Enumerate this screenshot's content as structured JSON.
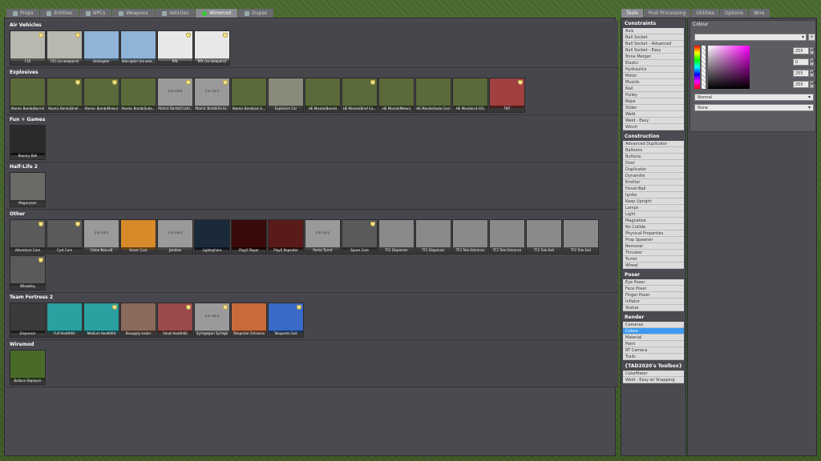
{
  "spawn_tabs": [
    {
      "label": "Props",
      "icon": "props-icon"
    },
    {
      "label": "Entities",
      "icon": "entities-icon"
    },
    {
      "label": "NPCs",
      "icon": "npcs-icon"
    },
    {
      "label": "Weapons",
      "icon": "weapons-icon"
    },
    {
      "label": "Vehicles",
      "icon": "vehicles-icon"
    },
    {
      "label": "Wiremod",
      "icon": "wiremod-icon",
      "active": true
    },
    {
      "label": "Dupes",
      "icon": "dupes-icon"
    }
  ],
  "categories": [
    {
      "title": "Air Vehicles",
      "items": [
        {
          "label": "F35",
          "color": "#b8b8b0",
          "badge": true
        },
        {
          "label": "F35 (no weapons)",
          "color": "#b8b8b0",
          "badge": true
        },
        {
          "label": "Helicopter",
          "color": "#8fb4d8",
          "badge": false
        },
        {
          "label": "Helicopter (no wea...",
          "color": "#8fb4d8",
          "badge": false
        },
        {
          "label": "RPL",
          "color": "#e8e8e8",
          "badge": true
        },
        {
          "label": "RPL (no weapons)",
          "color": "#e8e8e8",
          "badge": true
        }
      ]
    },
    {
      "title": "Explosives",
      "items": [
        {
          "label": "Atomic Bomb(Barrel)",
          "color": "#5a6a3a",
          "badge": false
        },
        {
          "label": "Atomic Bomb(Brief...",
          "color": "#5a6a3a",
          "badge": true
        },
        {
          "label": "Atomic Bomb(Melon)",
          "color": "#5a6a3a",
          "badge": true
        },
        {
          "label": "Atomic Bomb(Soda...",
          "color": "#5a6a3a",
          "badge": false
        },
        {
          "label": "Atomic Bomb(Custo...",
          "color": "#9a9a9a",
          "badge": true,
          "noicon": true
        },
        {
          "label": "Atomic Bomb(Invisi...",
          "color": "#9a9a9a",
          "badge": true,
          "noicon": true
        },
        {
          "label": "Atomic Bomb(s4-G...",
          "color": "#5a6a3a",
          "badge": false
        },
        {
          "label": "Explosive Car",
          "color": "#8a8a7a",
          "badge": false
        },
        {
          "label": "HE Missile(Barrel)",
          "color": "#5a6a3a",
          "badge": false
        },
        {
          "label": "HE Missile(Brief Ca...",
          "color": "#5a6a3a",
          "badge": true
        },
        {
          "label": "HE Missile(Melon)",
          "color": "#5a6a3a",
          "badge": false
        },
        {
          "label": "HE Missile(Soda Can)",
          "color": "#5a6a3a",
          "badge": false
        },
        {
          "label": "HE Missile(s4-G5)",
          "color": "#5a6a3a",
          "badge": false
        },
        {
          "label": "TNT",
          "color": "#a04040",
          "badge": true
        }
      ]
    },
    {
      "title": "Fun + Games",
      "items": [
        {
          "label": "Bouncy Ball",
          "color": "#2a2a2a",
          "badge": false
        }
      ]
    },
    {
      "title": "Half-Life 2",
      "items": [
        {
          "label": "Magnusson",
          "color": "#6a6a66",
          "badge": false
        }
      ]
    },
    {
      "title": "Other",
      "items": [
        {
          "label": "Adventure Core",
          "color": "#5a5a5a",
          "badge": true
        },
        {
          "label": "Cyst Core",
          "color": "#5a5a5a",
          "badge": true
        },
        {
          "label": "Globe Nexus8",
          "color": "#9a9a9a",
          "badge": false,
          "noicon": true
        },
        {
          "label": "Hover Core",
          "color": "#d88a2a",
          "badge": false
        },
        {
          "label": "Jukebox",
          "color": "#9a9a9a",
          "badge": false,
          "noicon": true
        },
        {
          "label": "Lightsphere",
          "color": "#1a2a3a",
          "badge": false
        },
        {
          "label": "PlayX Player",
          "color": "#3a0a0a",
          "badge": false
        },
        {
          "label": "PlayX Repeater",
          "color": "#5a1a1a",
          "badge": false
        },
        {
          "label": "Portal Turret",
          "color": "#9a9a9a",
          "badge": false,
          "noicon": true
        },
        {
          "label": "Space Core",
          "color": "#5a5a5a",
          "badge": true
        },
        {
          "label": "TF2 Dispenser",
          "color": "#8a8a8a",
          "badge": false
        },
        {
          "label": "TF2 Dispenser",
          "color": "#8a8a8a",
          "badge": false
        },
        {
          "label": "TF2 Tele Entrance",
          "color": "#8a8a8a",
          "badge": false
        },
        {
          "label": "TF2 Tele Entrance",
          "color": "#8a8a8a",
          "badge": false
        },
        {
          "label": "TF2 Tele Exit",
          "color": "#8a8a8a",
          "badge": false
        },
        {
          "label": "TF2 Tele Exit",
          "color": "#8a8a8a",
          "badge": false
        },
        {
          "label": "Wheatley",
          "color": "#5a5a5a",
          "badge": true
        }
      ]
    },
    {
      "title": "Team Fortress 2",
      "items": [
        {
          "label": "Dispenser",
          "color": "#3a3a3a",
          "badge": false
        },
        {
          "label": "Full HealthKit",
          "color": "#2aa0a0",
          "badge": false
        },
        {
          "label": "Medium HealthKit",
          "color": "#2aa0a0",
          "badge": true
        },
        {
          "label": "Resupply locker",
          "color": "#8a6a5a",
          "badge": false
        },
        {
          "label": "Small HealthKit",
          "color": "#9a4a4a",
          "badge": true
        },
        {
          "label": "Syringegun Syringe",
          "color": "#9a9a9a",
          "badge": true,
          "noicon": true
        },
        {
          "label": "Teleporter Entrance",
          "color": "#c86a3a",
          "badge": false
        },
        {
          "label": "Teleporter Exit",
          "color": "#3a6ac8",
          "badge": true
        }
      ]
    },
    {
      "title": "Wiremod",
      "items": [
        {
          "label": "Balloon Deployer",
          "color": "#4a6a2a",
          "badge": false
        }
      ]
    }
  ],
  "noicon_text": "(no icon)",
  "tool_tabs": [
    {
      "label": "Tools",
      "active": true
    },
    {
      "label": "Post Processing"
    },
    {
      "label": "Utilities"
    },
    {
      "label": "Options"
    },
    {
      "label": "Wire"
    }
  ],
  "tool_groups": [
    {
      "title": "Constraints",
      "items": [
        "Axis",
        "Ball Socket",
        "Ball Socket - Advanced",
        "Ball Socket - Easy",
        "Bone Merger",
        "Elastic",
        "Hydraulics",
        "Motor",
        "Muscle",
        "Nail",
        "Pulley",
        "Rope",
        "Slider",
        "Weld",
        "Weld - Easy",
        "Winch"
      ]
    },
    {
      "title": "Construction",
      "items": [
        "Advanced Duplicator",
        "Balloons",
        "Buttons",
        "Door",
        "Duplicator",
        "Dynamite",
        "Emitter",
        "Hover-Ball",
        "Ignite",
        "Keep Upright",
        "Lamps",
        "Light",
        "Magnetise",
        "No Collide",
        "Physical Properties",
        "Prop Spawner",
        "Remover",
        "Thruster",
        "Turret",
        "Wheel"
      ]
    },
    {
      "title": "Poser",
      "items": [
        "Eye Poser",
        "Face Poser",
        "Finger Poser",
        "Inflator",
        "Statue"
      ]
    },
    {
      "title": "Render",
      "items": [
        "Cameras",
        "Colour",
        "Material",
        "Paint",
        "RT Camera",
        "Trails"
      ],
      "selected": "Colour"
    },
    {
      "title": "{TAD2020's Toolbox}",
      "items": [
        "ColorMater",
        "Weld - Easy w/ Snapping"
      ]
    }
  ],
  "options": {
    "title": "Colour",
    "r": "255",
    "g": "0",
    "b": "255",
    "a": "255",
    "render_mode": "Normal",
    "render_fx": "None",
    "accent": "#3b9bf0"
  }
}
